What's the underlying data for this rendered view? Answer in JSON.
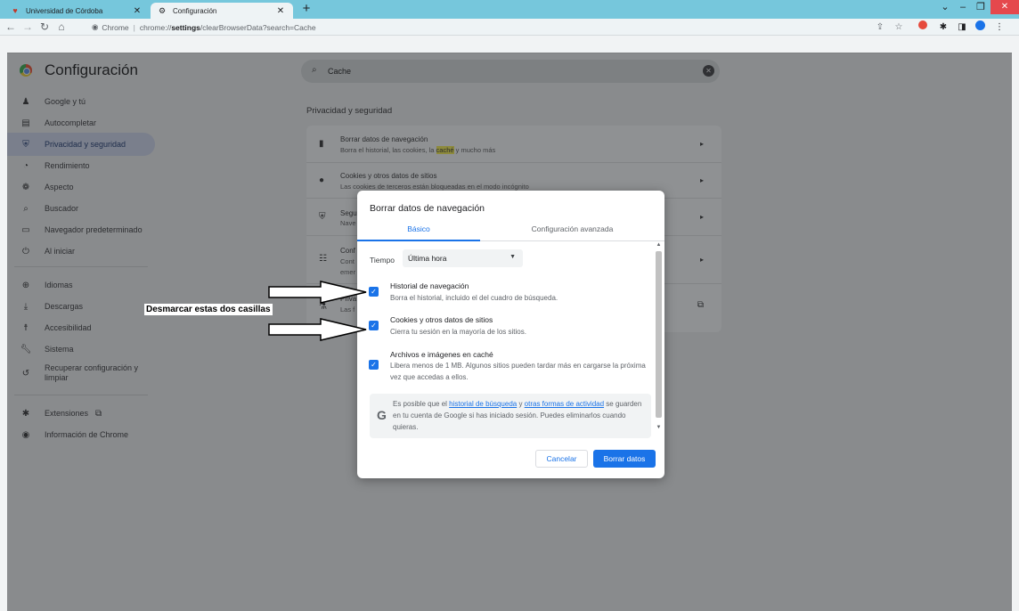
{
  "browser": {
    "tabs": [
      {
        "title": "Universidad de Córdoba",
        "icon": "university-favicon"
      },
      {
        "title": "Configuración",
        "icon": "gear-icon"
      }
    ],
    "address": {
      "chip": "Chrome",
      "host": "chrome://",
      "bold": "settings",
      "path": "/clearBrowserData?search=Cache"
    }
  },
  "settings": {
    "title": "Configuración",
    "search_value": "Cache",
    "nav": [
      {
        "label": "Google y tú",
        "icon": "person-icon"
      },
      {
        "label": "Autocompletar",
        "icon": "autofill-icon"
      },
      {
        "label": "Privacidad y seguridad",
        "icon": "shield-icon"
      },
      {
        "label": "Rendimiento",
        "icon": "performance-icon"
      },
      {
        "label": "Aspecto",
        "icon": "palette-icon"
      },
      {
        "label": "Buscador",
        "icon": "search-icon"
      },
      {
        "label": "Navegador predeterminado",
        "icon": "browser-icon"
      },
      {
        "label": "Al iniciar",
        "icon": "power-icon"
      },
      {
        "label": "Idiomas",
        "icon": "globe-icon"
      },
      {
        "label": "Descargas",
        "icon": "download-icon"
      },
      {
        "label": "Accesibilidad",
        "icon": "accessibility-icon"
      },
      {
        "label": "Sistema",
        "icon": "wrench-icon"
      },
      {
        "label": "Recuperar configuración y limpiar",
        "icon": "restore-icon"
      },
      {
        "label": "Extensiones",
        "icon": "puzzle-icon"
      },
      {
        "label": "Información de Chrome",
        "icon": "chrome-icon"
      }
    ],
    "section_title": "Privacidad y seguridad",
    "rows": [
      {
        "title": "Borrar datos de navegación",
        "desc_pre": "Borra el historial, las cookies, la ",
        "desc_hl": "caché",
        "desc_post": " y mucho más"
      },
      {
        "title": "Cookies y otros datos de sitios",
        "desc": "Las cookies de terceros están bloqueadas en el modo incógnito"
      },
      {
        "title": "Segu",
        "desc": "Nave"
      },
      {
        "title": "Conf",
        "desc": "Cont",
        "desc2": "emer"
      },
      {
        "title": "Priva",
        "desc": "Las f"
      }
    ]
  },
  "dialog": {
    "title": "Borrar datos de navegación",
    "tabs": [
      "Básico",
      "Configuración avanzada"
    ],
    "time_label": "Tiempo",
    "time_value": "Última hora",
    "options": [
      {
        "title": "Historial de navegación",
        "desc": "Borra el historial, incluido el del cuadro de búsqueda.",
        "checked": true
      },
      {
        "title": "Cookies y otros datos de sitios",
        "desc": "Cierra tu sesión en la mayoría de los sitios.",
        "checked": true
      },
      {
        "title": "Archivos e imágenes en caché",
        "desc": "Libera menos de 1 MB. Algunos sitios pueden tardar más en cargarse la próxima vez que accedas a ellos.",
        "checked": true
      }
    ],
    "google_note": {
      "pre": "Es posible que el ",
      "link1": "historial de búsqueda",
      "mid": " y ",
      "link2": "otras formas de actividad",
      "post": " se guarden en tu cuenta de Google si has iniciado sesión. Puedes eliminarlos cuando quieras."
    },
    "cancel_label": "Cancelar",
    "confirm_label": "Borrar datos"
  },
  "annotation": {
    "label": "Desmarcar estas dos casillas"
  },
  "colors": {
    "accent": "#1a73e8",
    "tabstrip": "#76c7dc",
    "overlay_bg": "#898b8d",
    "close_red": "#e5484d"
  }
}
